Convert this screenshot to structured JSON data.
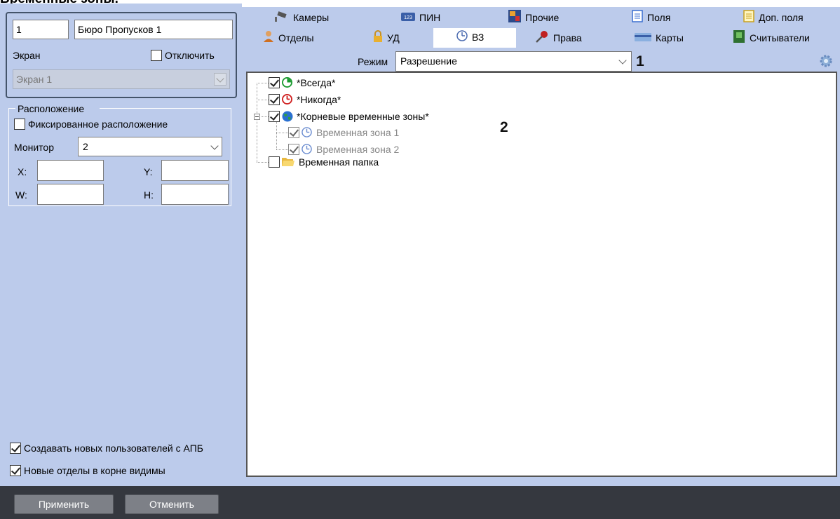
{
  "heading": "Временные зоны.",
  "left": {
    "id_value": "1",
    "name_value": "Бюро Пропусков 1",
    "screen_label": "Экран",
    "disable_label": "Отключить",
    "screen_select": "Экран 1",
    "location_label": "Расположение",
    "fixed_label": "Фиксированное расположение",
    "monitor_label": "Монитор",
    "monitor_value": "2",
    "x_label": "X:",
    "y_label": "Y:",
    "w_label": "W:",
    "h_label": "H:",
    "x_value": "",
    "y_value": "",
    "w_value": "",
    "h_value": "",
    "create_users_label": "Создавать новых пользователей с АПБ",
    "new_depts_label": "Новые отделы в корне видимы"
  },
  "buttons": {
    "apply": "Применить",
    "cancel": "Отменить"
  },
  "tabs": {
    "row1": [
      {
        "label": "Камеры",
        "icon": "camera-icon"
      },
      {
        "label": "ПИН",
        "icon": "pin-icon"
      },
      {
        "label": "Прочие",
        "icon": "other-icon"
      },
      {
        "label": "Поля",
        "icon": "fields-icon"
      },
      {
        "label": "Доп. поля",
        "icon": "extra-fields-icon"
      }
    ],
    "row2": [
      {
        "label": "Отделы",
        "icon": "person-icon"
      },
      {
        "label": "УД",
        "icon": "lock-icon"
      },
      {
        "label": "ВЗ",
        "icon": "clock-icon",
        "active": true
      },
      {
        "label": "Права",
        "icon": "key-icon"
      },
      {
        "label": "Карты",
        "icon": "card-icon"
      },
      {
        "label": "Считыватели",
        "icon": "reader-icon"
      }
    ]
  },
  "toolbar": {
    "mode_label": "Режим",
    "mode_value": "Разрешение",
    "annotation_1": "1",
    "annotation_2": "2"
  },
  "tree": [
    {
      "label": "*Всегда*",
      "checked": true,
      "icon": "green-clock-icon"
    },
    {
      "label": "*Никогда*",
      "checked": true,
      "icon": "red-clock-icon"
    },
    {
      "label": "*Корневые временные зоны*",
      "checked": true,
      "icon": "globe-icon"
    },
    {
      "label": "Временная зона 1",
      "checked": true,
      "icon": "blue-clock-icon"
    },
    {
      "label": "Временная зона 2",
      "checked": true,
      "icon": "blue-clock-icon"
    },
    {
      "label": "Временная папка",
      "checked": false,
      "icon": "folder-icon"
    }
  ],
  "colors": {
    "panel_bg": "#bccbeb",
    "bottom_bar": "#35383f",
    "button_bg": "#7d8087"
  }
}
